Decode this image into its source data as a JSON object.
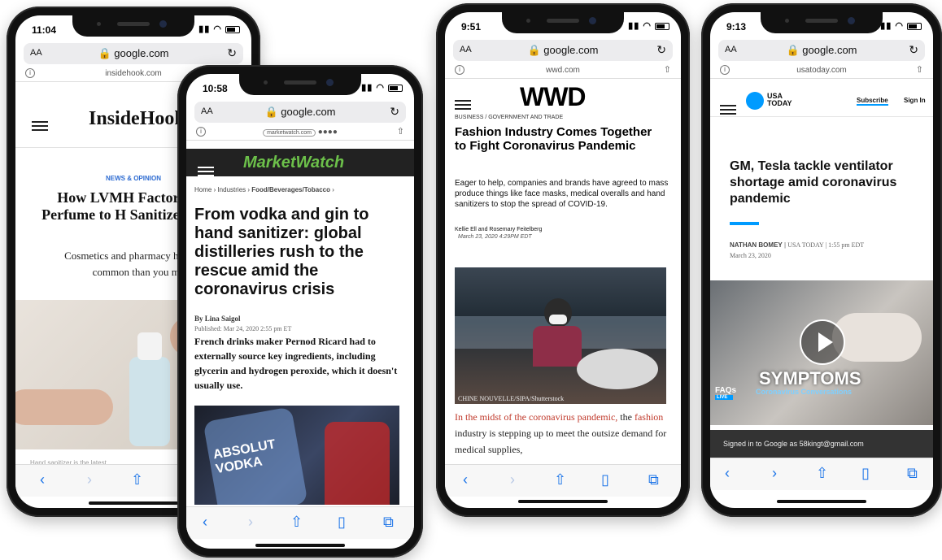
{
  "phones": [
    {
      "time": "11:04",
      "url": "google.com",
      "host": "insidehook.com",
      "site_logo": "InsideHook",
      "kicker": "NEWS & OPINION",
      "headline": "How LVMH Factories From Perfume to H Sanitizer in Just 72",
      "dek": "Cosmetics and pharmacy have more in common than you may th",
      "footer_text": "Hand sanitizer is the latest"
    },
    {
      "time": "10:58",
      "url": "google.com",
      "host": "marketwatch.com",
      "site_logo": "MarketWatch",
      "breadcrumb": [
        "Home",
        "Industries",
        "Food/Beverages/Tobacco"
      ],
      "headline": "From vodka and gin to hand sanitizer: global distilleries rush to the rescue amid the coronavirus crisis",
      "byline": "By Lina Saigol",
      "published": "Published: Mar 24, 2020 2:55 pm ET",
      "body": "French drinks maker Pernod Ricard had to externally source key ingredients, including glycerin and hydrogen peroxide, which it doesn't usually use.",
      "image_text": "ABSOLUT VODKA"
    },
    {
      "time": "9:51",
      "url": "google.com",
      "host": "wwd.com",
      "site_logo": "WWD",
      "section": "BUSINESS / GOVERNMENT AND TRADE",
      "headline": "Fashion Industry Comes Together to Fight Coronavirus Pandemic",
      "dek": "Eager to help, companies and brands have agreed to mass produce things like face masks, medical overalls and hand sanitizers to stop the spread of COVID-19.",
      "authors": "Kellie Ell and Rosemary Feitelberg",
      "date": "March 23, 2020 4:29PM EDT",
      "credit": "CHINE NOUVELLE/SIPA/Shutterstock",
      "body_link1": "In the midst of the coronavirus pandemic,",
      "body_text1": " the ",
      "body_link2": "fashion",
      "body_text2": " industry is stepping up to meet the outsize demand for medical supplies,"
    },
    {
      "time": "9:13",
      "url": "google.com",
      "host": "usatoday.com",
      "site_logo": "USA TODAY",
      "subscribe": "Subscribe",
      "signin": "Sign In",
      "headline": "GM, Tesla tackle ventilator shortage amid coronavirus pandemic",
      "author": "NATHAN BOMEY",
      "outlet_time": "USA TODAY | 1:55 pm EDT",
      "date": "March 23, 2020",
      "video_label": "SYMPTOMS",
      "faq_label": "FAQs",
      "live_label": "LIVE",
      "faq_sub": "Coronavirus Conversations",
      "signed_in": "Signed in to Google as 58kingt@gmail.com"
    }
  ],
  "colors": {
    "link_blue": "#1a73e8",
    "mw_green": "#6cc04a",
    "wwd_red": "#c0392b",
    "usa_blue": "#009bff"
  }
}
